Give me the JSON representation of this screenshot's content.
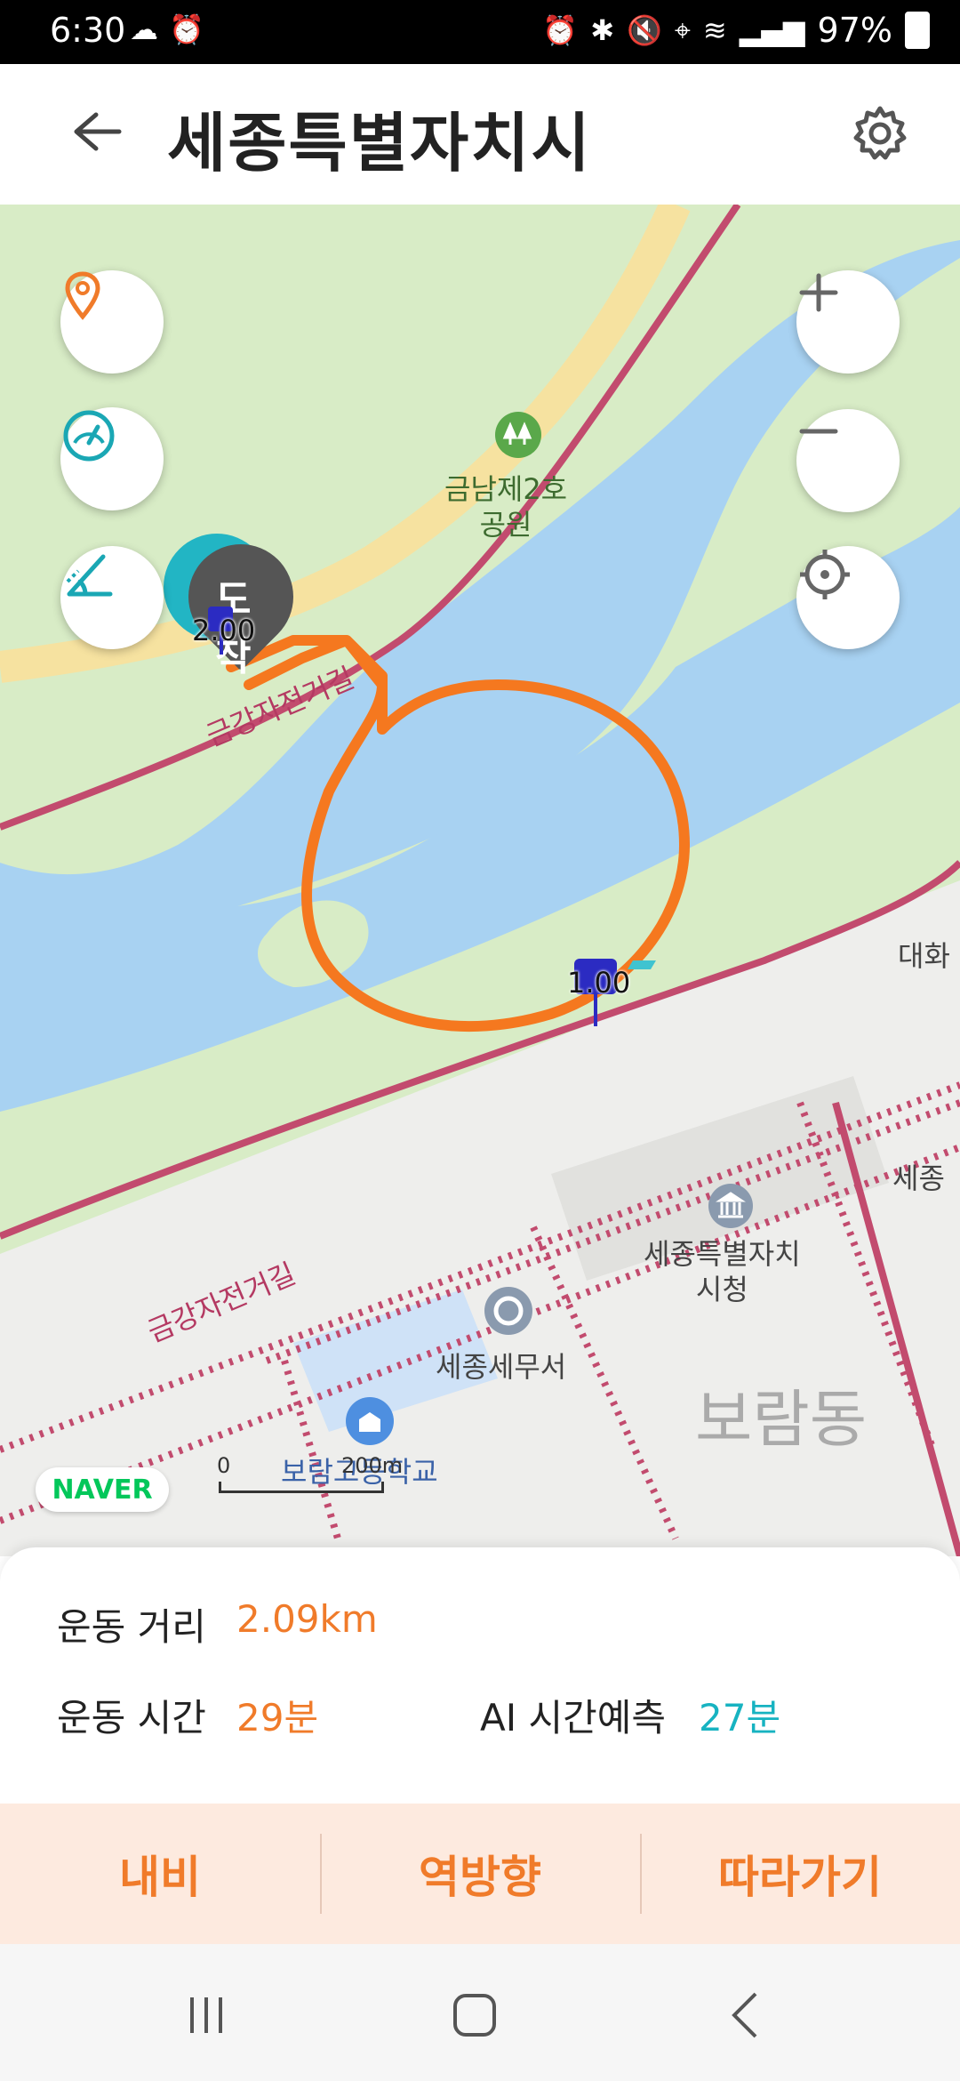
{
  "status_bar": {
    "time": "6:30",
    "battery": "97%"
  },
  "header": {
    "title": "세종특별자치시"
  },
  "map": {
    "labels": {
      "park": "금남제2호\n공원",
      "bike_path_1": "금강자전거길",
      "bike_path_2": "금강자전거길",
      "city_hall": "세종특별자치\n시청",
      "tax_office": "세종세무서",
      "school": "보람고등학교",
      "district": "보람동",
      "daehwa": "대화",
      "sejong_right": "세종",
      "arrival_pin": "도착",
      "marker_2": "2.00",
      "marker_1": "1.00"
    },
    "naver_logo": "NAVER",
    "scale": {
      "zero": "0",
      "distance": "200m"
    },
    "route_color": "#f5781f"
  },
  "stats": {
    "distance_label": "운동 거리",
    "distance_value": "2.09km",
    "time_label": "운동 시간",
    "time_value": "29분",
    "ai_label": "AI 시간예측",
    "ai_value": "27분"
  },
  "actions": {
    "nav": "내비",
    "reverse": "역방향",
    "follow": "따라가기"
  },
  "colors": {
    "accent_orange": "#f07b2a",
    "accent_teal": "#17b3c1"
  }
}
